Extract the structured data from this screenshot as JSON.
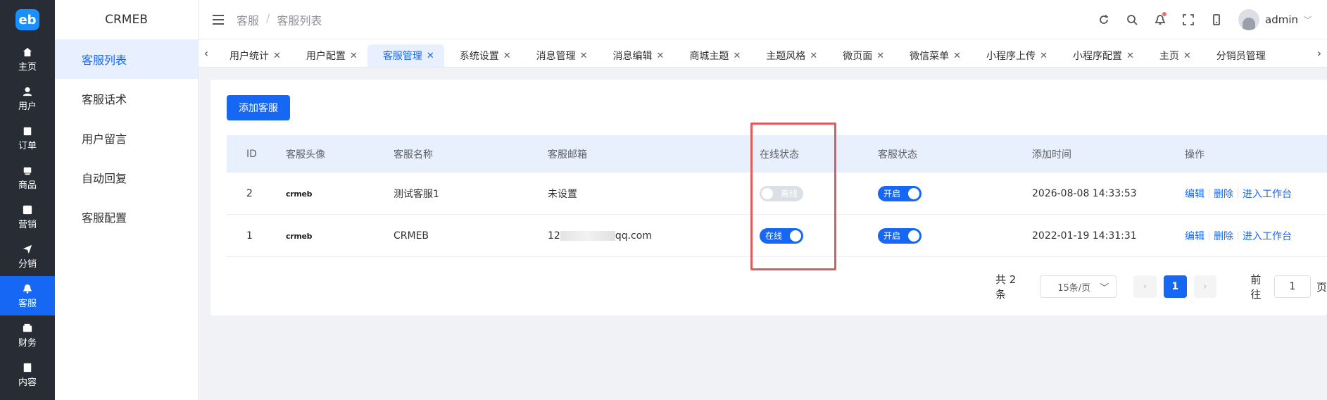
{
  "rail": {
    "logo": "eb",
    "items": [
      {
        "label": "主页",
        "icon": "home-icon"
      },
      {
        "label": "用户",
        "icon": "user-icon"
      },
      {
        "label": "订单",
        "icon": "order-icon"
      },
      {
        "label": "商品",
        "icon": "goods-icon"
      },
      {
        "label": "营销",
        "icon": "marketing-icon"
      },
      {
        "label": "分销",
        "icon": "send-icon"
      },
      {
        "label": "客服",
        "icon": "bell-icon"
      },
      {
        "label": "财务",
        "icon": "wallet-icon"
      },
      {
        "label": "内容",
        "icon": "content-icon"
      }
    ]
  },
  "sidebar": {
    "brand": "CRMEB",
    "items": [
      {
        "label": "客服列表"
      },
      {
        "label": "客服话术"
      },
      {
        "label": "用户留言"
      },
      {
        "label": "自动回复"
      },
      {
        "label": "客服配置"
      }
    ]
  },
  "header": {
    "breadcrumb": [
      "客服",
      "/",
      "客服列表"
    ],
    "username": "admin"
  },
  "tabs": [
    "用户统计",
    "用户配置",
    "客服管理",
    "系统设置",
    "消息管理",
    "消息编辑",
    "商城主题",
    "主题风格",
    "微页面",
    "微信菜单",
    "小程序上传",
    "小程序配置",
    "主页",
    "分销员管理"
  ],
  "content": {
    "add_button": "添加客服",
    "columns": [
      "ID",
      "客服头像",
      "客服名称",
      "客服邮箱",
      "在线状态",
      "客服状态",
      "添加时间",
      "操作"
    ],
    "rows": [
      {
        "id": "2",
        "avatar": "crmeb",
        "name": "测试客服1",
        "email_prefix": "未设置",
        "email_suffix": "",
        "online": "离线",
        "status": "开启",
        "time": "2026-08-08 14:33:53"
      },
      {
        "id": "1",
        "avatar": "crmeb",
        "name": "CRMEB",
        "email_prefix": "12",
        "email_suffix": "qq.com",
        "online": "在线",
        "status": "开启",
        "time": "2022-01-19 14:31:31"
      }
    ],
    "actions": {
      "edit": "编辑",
      "delete": "删除",
      "workbench": "进入工作台"
    }
  },
  "pagination": {
    "total": "共 2 条",
    "page_size": "15条/页",
    "current": "1",
    "goto_label": "前往",
    "goto_value": "1",
    "page_unit": "页",
    "prev": "‹",
    "next": "›"
  },
  "colors": {
    "primary": "#1767f5",
    "rail_bg": "#282c34",
    "highlight": "#e45a5a"
  }
}
